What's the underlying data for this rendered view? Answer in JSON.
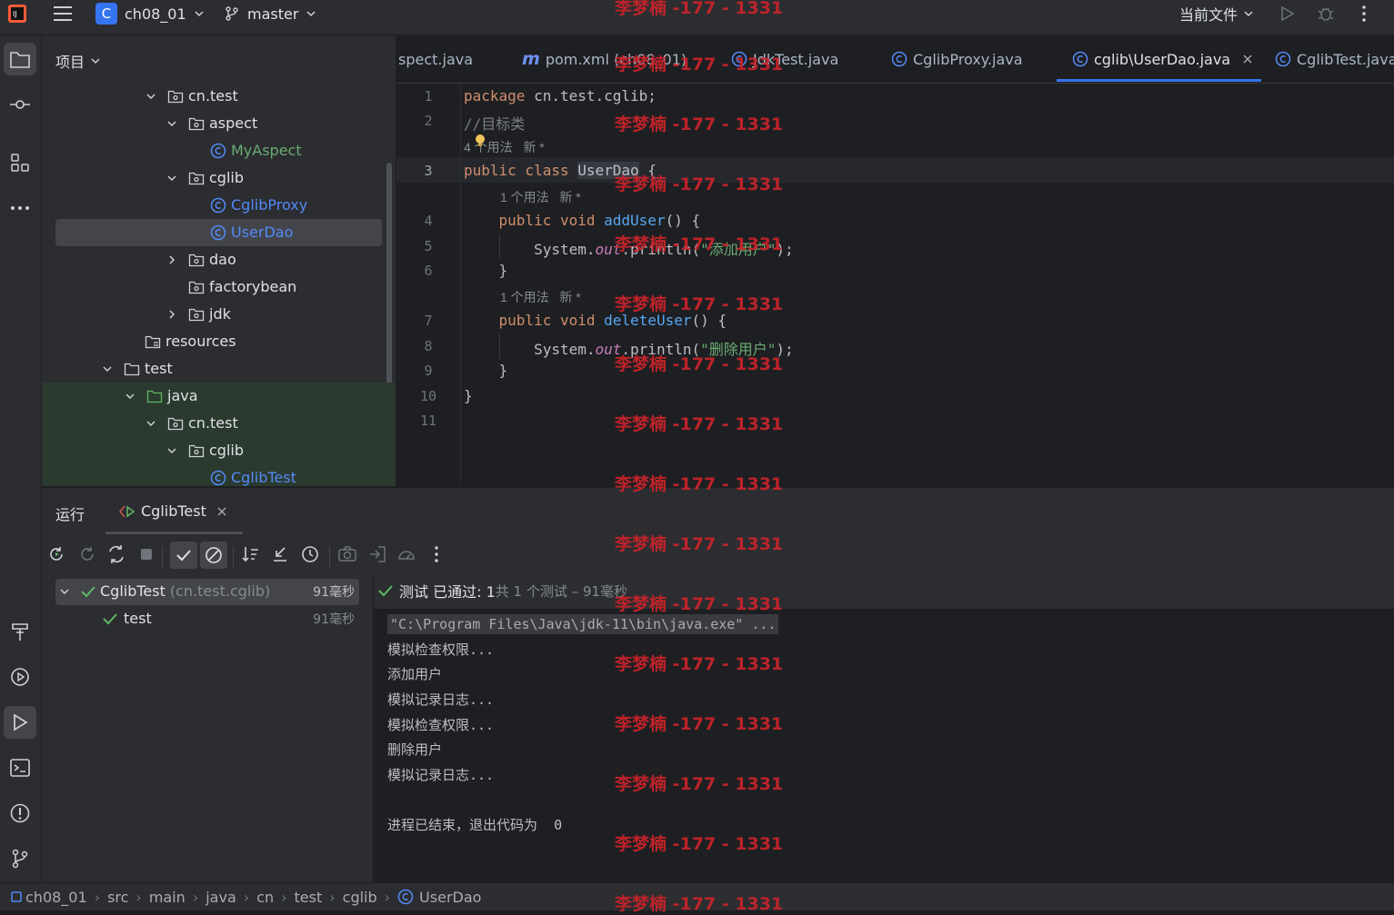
{
  "topbar": {
    "project_letter": "C",
    "project_name": "ch08_01",
    "branch": "master",
    "run_config": "当前文件"
  },
  "project_panel": {
    "title": "项目",
    "tree": [
      {
        "label": "cn.test",
        "type": "package",
        "expanded": true
      },
      {
        "label": "aspect",
        "type": "package",
        "expanded": true
      },
      {
        "label": "MyAspect",
        "type": "class"
      },
      {
        "label": "cglib",
        "type": "package",
        "expanded": true
      },
      {
        "label": "CglibProxy",
        "type": "class"
      },
      {
        "label": "UserDao",
        "type": "class",
        "selected": true
      },
      {
        "label": "dao",
        "type": "package",
        "expanded": false
      },
      {
        "label": "factorybean",
        "type": "package"
      },
      {
        "label": "jdk",
        "type": "package",
        "expanded": false
      },
      {
        "label": "resources",
        "type": "resources"
      },
      {
        "label": "test",
        "type": "folder",
        "expanded": true
      },
      {
        "label": "java",
        "type": "folder",
        "expanded": true
      },
      {
        "label": "cn.test",
        "type": "package",
        "expanded": true
      },
      {
        "label": "cglib",
        "type": "package",
        "expanded": true
      },
      {
        "label": "CglibTest",
        "type": "class"
      }
    ]
  },
  "editor_tabs": [
    {
      "label": "spect.java",
      "icon": "class"
    },
    {
      "label": "pom.xml (ch08_01)",
      "icon": "maven"
    },
    {
      "label": "JdkTest.java",
      "icon": "class"
    },
    {
      "label": "CglibProxy.java",
      "icon": "class"
    },
    {
      "label": "cglib\\UserDao.java",
      "icon": "class",
      "active": true
    },
    {
      "label": "CglibTest.java",
      "icon": "class"
    }
  ],
  "editor": {
    "line_numbers": [
      "1",
      "2",
      "3",
      "4",
      "5",
      "6",
      "7",
      "8",
      "9",
      "10",
      "11"
    ],
    "hints": {
      "class_usage": "4 个用法   新 *",
      "add_usage": "1 个用法   新 *",
      "del_usage": "1 个用法   新 *"
    },
    "code": {
      "l1_kw": "package",
      "l1_rest": " cn.test.cglib;",
      "l2": "//目标类",
      "l3_kw": "public class",
      "l3_name": "UserDao",
      "l3_rest": " {",
      "l4_kw": "public void",
      "l4_fn": "addUser",
      "l4_rest": "() {",
      "l5_a": "System.",
      "l5_out": "out",
      "l5_b": ".println(",
      "l5_str": "\"添加用户\"",
      "l5_c": ");",
      "l6": "}",
      "l7_kw": "public void",
      "l7_fn": "deleteUser",
      "l7_rest": "() {",
      "l8_a": "System.",
      "l8_out": "out",
      "l8_b": ".println(",
      "l8_str": "\"删除用户\"",
      "l8_c": ");",
      "l9": "}",
      "l10": "}"
    }
  },
  "run_panel": {
    "title": "运行",
    "tab": "CglibTest",
    "status_prefix": "测试 已通过: 1",
    "status_suffix": "共 1 个测试 – 91毫秒",
    "tree": {
      "suite": "CglibTest",
      "suite_pkg": "(cn.test.cglib)",
      "suite_time": "91毫秒",
      "test": "test",
      "test_time": "91毫秒"
    },
    "console": [
      "\"C:\\Program Files\\Java\\jdk-11\\bin\\java.exe\" ...",
      "模拟检查权限...",
      "添加用户",
      "模拟记录日志...",
      "模拟检查权限...",
      "删除用户",
      "模拟记录日志...",
      "",
      "进程已结束，退出代码为  0"
    ]
  },
  "breadcrumb": [
    "ch08_01",
    "src",
    "main",
    "java",
    "cn",
    "test",
    "cglib",
    "UserDao"
  ],
  "watermark": "李梦楠 -177 - 1331",
  "colors": {
    "accent": "#3574f0",
    "class_icon": "#548af7",
    "pass_green": "#5fb865",
    "watermark": "#c9242a"
  }
}
